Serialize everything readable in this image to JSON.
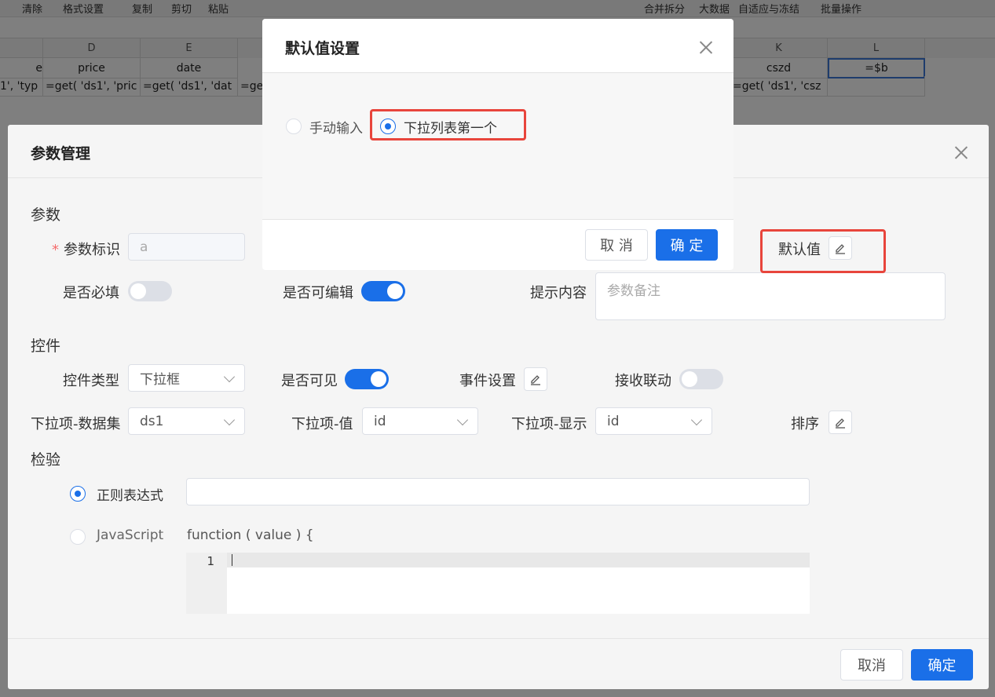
{
  "toolbar": {
    "items": [
      "清除",
      "格式设置",
      "复制",
      "剪切",
      "粘贴",
      "合并拆分",
      "大数据",
      "自适应与冻结",
      "批量操作"
    ]
  },
  "sheet": {
    "columns": {
      "D": "D",
      "E": "E",
      "K": "K",
      "L": "L"
    },
    "row1": {
      "c": "e",
      "D": "price",
      "E": "date",
      "K": "cszd",
      "L": "=$b"
    },
    "row2": {
      "c": "1', 'typ",
      "D": "=get( 'ds1', 'pric",
      "E": "=get( 'ds1', 'dat",
      "F": "=ge",
      "K": "=get( 'ds1', 'csz"
    }
  },
  "param_dialog": {
    "title": "参数管理",
    "section_param": "参数",
    "param_id_label": "参数标识",
    "param_id_value": "a",
    "required_label": "是否必填",
    "required_on": false,
    "editable_label": "是否可编辑",
    "editable_on": true,
    "hint_label": "提示内容",
    "hint_placeholder": "参数备注",
    "default_label": "默认值",
    "section_control": "控件",
    "control_type_label": "控件类型",
    "control_type_value": "下拉框",
    "visible_label": "是否可见",
    "visible_on": true,
    "event_label": "事件设置",
    "link_label": "接收联动",
    "link_on": false,
    "dataset_label": "下拉项-数据集",
    "dataset_value": "ds1",
    "value_label": "下拉项-值",
    "value_value": "id",
    "display_label": "下拉项-显示",
    "display_value": "id",
    "sort_label": "排序",
    "section_check": "检验",
    "regex_label": "正则表达式",
    "js_label": "JavaScript",
    "js_signature": "function ( value ) {",
    "code_line": "1",
    "cancel": "取消",
    "confirm": "确定"
  },
  "default_dialog": {
    "title": "默认值设置",
    "option_manual": "手动输入",
    "option_first": "下拉列表第一个",
    "selected": "option_first",
    "cancel": "取 消",
    "confirm": "确 定"
  },
  "colors": {
    "primary": "#1a6fe8",
    "highlight": "#e8453c"
  }
}
